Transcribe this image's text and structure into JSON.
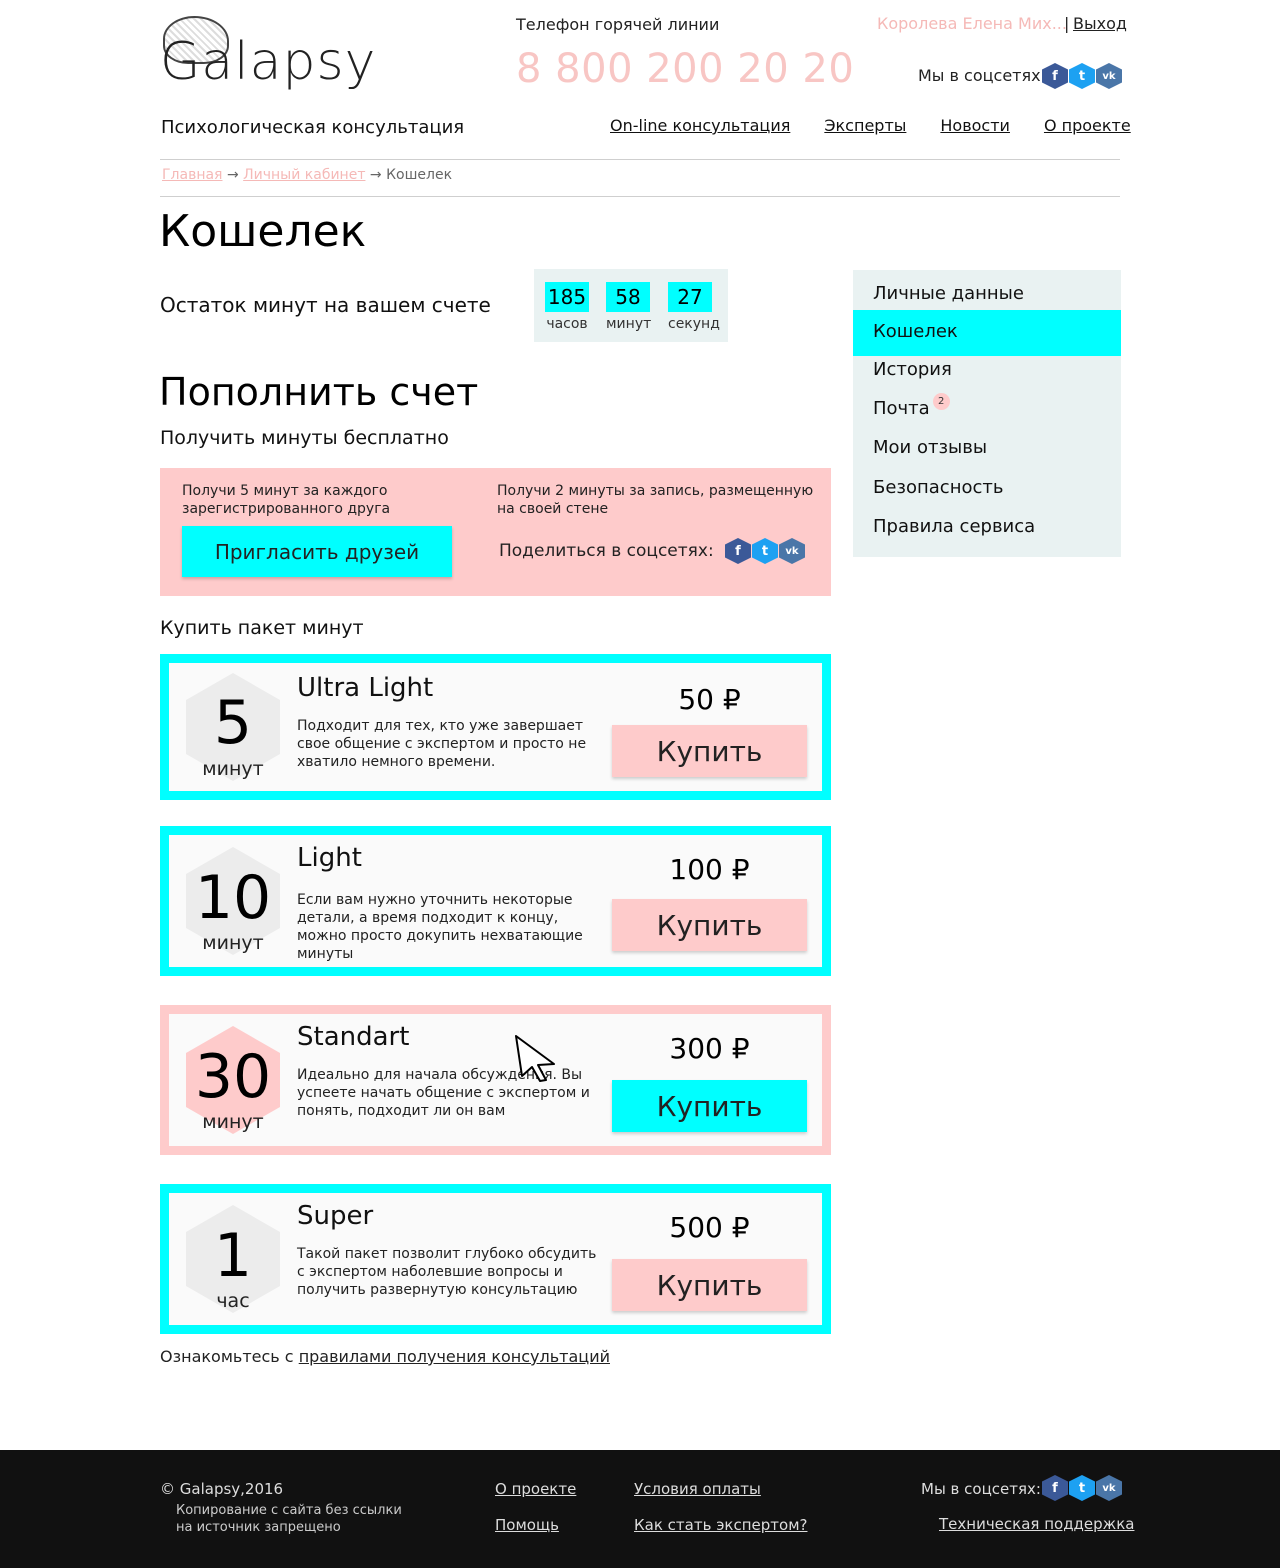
{
  "header": {
    "logo": "Galapsy",
    "tagline": "Психологическая консультация",
    "hotline_label": "Телефон горячей линии",
    "hotline_phone": "8 800 200 20 20",
    "user_name": "Королева Елена Мих...",
    "separator": "|",
    "logout": "Выход",
    "social_label": "Мы в соцсетях"
  },
  "nav": [
    "On-line консультация",
    "Эксперты",
    "Новости",
    "О проекте"
  ],
  "breadcrumb": {
    "home": "Главная",
    "cabinet": "Личный кабинет",
    "current": "Кошелек",
    "arrow": "→"
  },
  "page_title": "Кошелек",
  "balance": {
    "label": "Остаток минут на вашем счете",
    "hours": "185",
    "hours_label": "часов",
    "minutes": "58",
    "minutes_label": "минут",
    "seconds": "27",
    "seconds_label": "секунд"
  },
  "refill": {
    "title": "Пополнить счет",
    "free_title": "Получить минуты бесплатно",
    "invite_text": "Получи 5 минут за каждого зарегистрированного друга",
    "invite_button": "Пригласить друзей",
    "share_text": "Получи 2 минуты за запись, размещенную на своей стене",
    "share_label": "Поделиться в соцсетях:",
    "buy_title": "Купить пакет минут"
  },
  "packages": [
    {
      "amount": "5",
      "unit": "минут",
      "name": "Ultra Light",
      "desc": "Подходит для тех, кто уже завершает свое общение с экспертом и просто не хватило немного времени.",
      "price": "50 ₽",
      "button": "Купить"
    },
    {
      "amount": "10",
      "unit": "минут",
      "name": "Light",
      "desc": "Если вам нужно уточнить некоторые детали, а время подходит к концу, можно просто докупить нехватающие минуты",
      "price": "100 ₽",
      "button": "Купить"
    },
    {
      "amount": "30",
      "unit": "минут",
      "name": "Standart",
      "desc": "Идеально для начала обсуждения. Вы успеете начать общение с экспертом и понять, подходит ли он вам",
      "price": "300 ₽",
      "button": "Купить"
    },
    {
      "amount": "1",
      "unit": "час",
      "name": "Super",
      "desc": "Такой пакет позволит глубоко обсудить с экспертом наболевшие вопросы и получить развернутую консультацию",
      "price": "500 ₽",
      "button": "Купить"
    }
  ],
  "rules_note": {
    "prefix": "Ознакомьтесь с ",
    "link": "правилами получения консультаций"
  },
  "sidebar": {
    "items": [
      "Личные данные",
      "Кошелек",
      "История",
      "Почта",
      "Мои отзывы",
      "Безопасность",
      "Правила сервиса"
    ],
    "active": "Кошелек",
    "mail_badge": "2"
  },
  "social_icons": {
    "fb": "f",
    "tw": "t",
    "vk": "vk"
  },
  "footer": {
    "copyright": "© Galapsy,2016",
    "note": "Копирование с сайта без ссылки на источник запрещено",
    "links": [
      "О проекте",
      "Условия оплаты",
      "Помощь",
      "Как стать экспертом?"
    ],
    "social_label": "Мы в соцсетях:",
    "support": "Техническая поддержка"
  },
  "colors": {
    "accent_cyan": "#00ffff",
    "accent_pink": "#fecbcb",
    "phone_pink": "#f8c6c4",
    "sidebar_bg": "#e9f2f2",
    "footer_bg": "#111111"
  }
}
